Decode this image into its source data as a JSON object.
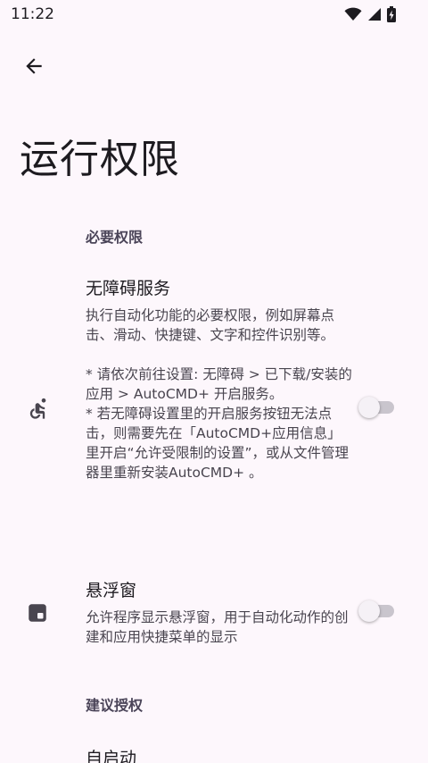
{
  "status_bar": {
    "time": "11:22",
    "icons": [
      "wifi-icon",
      "cellular-signal-icon",
      "battery-icon"
    ]
  },
  "header": {
    "back_icon": "arrow-back-icon",
    "title": "运行权限"
  },
  "sections": [
    {
      "title": "必要权限",
      "items": [
        {
          "icon": "accessibility-icon",
          "title": "无障碍服务",
          "summary": "执行自动化功能的必要权限，例如屏幕点击、滑动、快捷键、文字和控件识别等。\n\n* 请依次前往设置: 无障碍 > 已下载/安装的应用 > AutoCMD+ 开启服务。\n* 若无障碍设置里的开启服务按钮无法点击，则需要先在「AutoCMD+应用信息」里开启“允许受限制的设置”，或从文件管理器里重新安装AutoCMD+ 。",
          "enabled": false
        },
        {
          "icon": "floating-window-icon",
          "title": "悬浮窗",
          "summary": "允许程序显示悬浮窗，用于自动化动作的创建和应用快捷菜单的显示",
          "enabled": false
        }
      ]
    },
    {
      "title": "建议授权",
      "items": [
        {
          "title": "自启动"
        }
      ]
    }
  ],
  "colors": {
    "background": "#fdf7fc",
    "text_primary": "#1d1b20",
    "text_secondary": "#49454f",
    "section_header": "#4a4458",
    "switch_track_off": "#c9c5cd"
  }
}
